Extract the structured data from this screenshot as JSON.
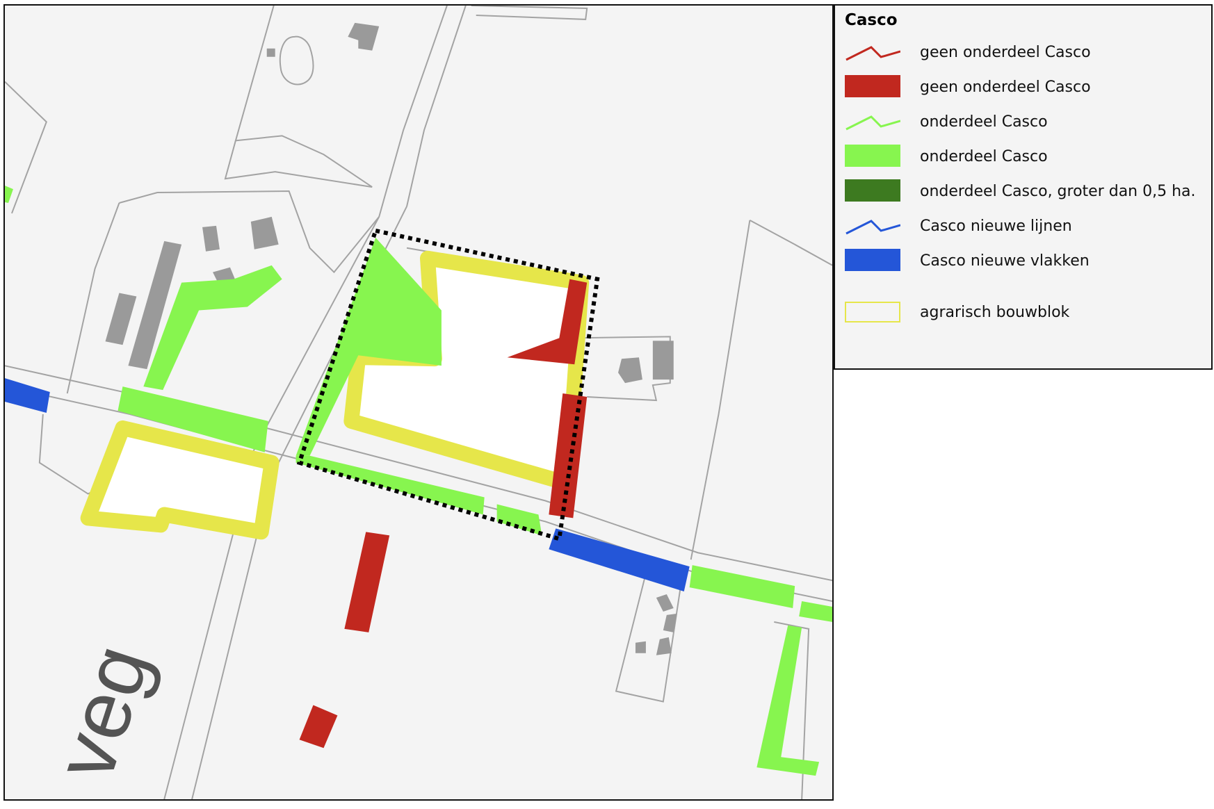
{
  "map": {
    "street_label": "veg",
    "colors": {
      "background": "#f4f4f4",
      "parcel_line": "#a3a3a3",
      "building": "#9a9a9a",
      "red": "#c1281f",
      "light_green": "#87f54f",
      "dark_green": "#3d7a20",
      "blue": "#2456d8",
      "yellow": "#e6e64a",
      "white": "#ffffff",
      "dotted_border": "#000000"
    }
  },
  "legend": {
    "title": "Casco",
    "items": [
      {
        "label": "geen onderdeel Casco",
        "symbol": "line",
        "color": "#c1281f"
      },
      {
        "label": "geen onderdeel Casco",
        "symbol": "fill",
        "color": "#c1281f"
      },
      {
        "label": "onderdeel Casco",
        "symbol": "line",
        "color": "#87f54f"
      },
      {
        "label": "onderdeel Casco",
        "symbol": "fill",
        "color": "#87f54f"
      },
      {
        "label": "onderdeel Casco, groter dan 0,5 ha.",
        "symbol": "fill",
        "color": "#3d7a20"
      },
      {
        "label": "Casco nieuwe lijnen",
        "symbol": "line",
        "color": "#2456d8"
      },
      {
        "label": "Casco nieuwe vlakken",
        "symbol": "fill",
        "color": "#2456d8"
      },
      {
        "label": "agrarisch bouwblok",
        "symbol": "outline",
        "color": "#e6e64a"
      }
    ]
  }
}
